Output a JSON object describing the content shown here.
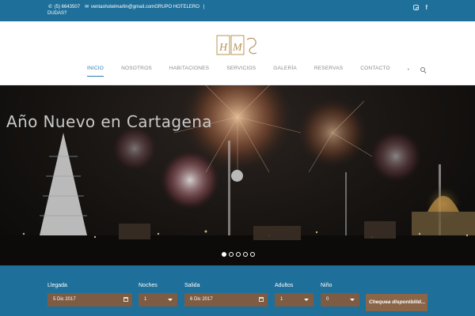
{
  "topbar": {
    "phone": "(5) 6643507",
    "email": "ventashotelmarlin@gmail.com",
    "group": "GRUPO HOTELERO",
    "separator": "|",
    "faq": "DUDAS?",
    "phone_icon": "phone-icon",
    "email_icon": "envelope-icon",
    "social": [
      "instagram-icon",
      "facebook-icon"
    ]
  },
  "header": {
    "logo_icon": "hotel-logo",
    "nav": [
      {
        "label": "INICIO",
        "active": true
      },
      {
        "label": "NOSOTROS",
        "active": false
      },
      {
        "label": "HABITACIONES",
        "active": false
      },
      {
        "label": "SERVICIOS",
        "active": false
      },
      {
        "label": "GALERÍA",
        "active": false
      },
      {
        "label": "RESERVAS",
        "active": false
      },
      {
        "label": "CONTACTO",
        "active": false
      }
    ],
    "extra_marker": "•",
    "search_icon": "search-icon"
  },
  "hero": {
    "title": "Año Nuevo en Cartagena",
    "slides": 5,
    "active_slide": 1
  },
  "booking": {
    "arrival": {
      "label": "Llegada",
      "value": "5 Dic 2017"
    },
    "nights": {
      "label": "Noches",
      "value": "1"
    },
    "departure": {
      "label": "Salida",
      "value": "6 Dic 2017"
    },
    "adults": {
      "label": "Adultos",
      "value": "1"
    },
    "children": {
      "label": "Niño",
      "value": "0"
    },
    "check_button": "Chequea disponibilid..."
  },
  "colors": {
    "primary_blue": "#1e6f9a",
    "nav_active": "#2a7fb0",
    "field_brown": "#7d5c43"
  }
}
